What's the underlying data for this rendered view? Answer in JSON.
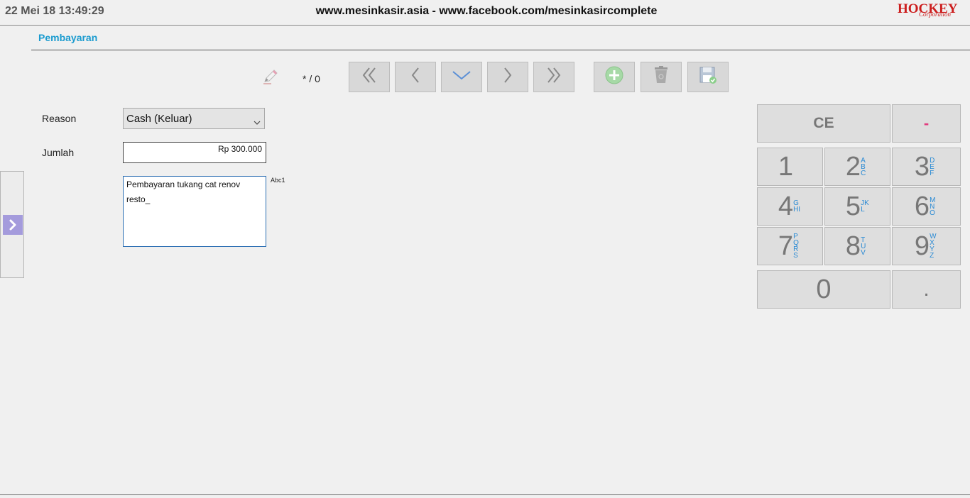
{
  "header": {
    "datetime": "22 Mei 18 13:49:29",
    "site_title": "www.mesinkasir.asia - www.facebook.com/mesinkasircomplete",
    "logo_brand": "HOCKEY",
    "logo_sub": "Corporation"
  },
  "section": {
    "title": "Pembayaran"
  },
  "record": {
    "position": "* / 0"
  },
  "form": {
    "reason_label": "Reason",
    "reason_value": "Cash (Keluar)",
    "amount_label": "Jumlah",
    "amount_value": "Rp 300.000",
    "note_value": "Pembayaran tukang cat renov\nresto_",
    "input_mode": "Abc1"
  },
  "keypad": {
    "ce": "CE",
    "minus": "-",
    "dot": ".",
    "keys": [
      {
        "digit": "1",
        "letters": ""
      },
      {
        "digit": "2",
        "letters": "ABC"
      },
      {
        "digit": "3",
        "letters": "DEF"
      },
      {
        "digit": "4",
        "letters": "GHI"
      },
      {
        "digit": "5",
        "letters": "JKL"
      },
      {
        "digit": "6",
        "letters": "MNO"
      },
      {
        "digit": "7",
        "letters": "PQRS"
      },
      {
        "digit": "8",
        "letters": "TUV"
      },
      {
        "digit": "9",
        "letters": "WXYZ"
      },
      {
        "digit": "0",
        "letters": ""
      }
    ]
  },
  "colors": {
    "accent": "#1a9bcf",
    "keypad_letters": "#2a8ad4",
    "minus_key": "#e23c7e",
    "side_arrow": "#a49bdc",
    "logo": "#cc1d1d"
  },
  "icons": {
    "nav": [
      "first-record-icon",
      "previous-record-icon",
      "down-icon",
      "next-record-icon",
      "last-record-icon"
    ],
    "actions": [
      "add-icon",
      "delete-icon",
      "save-icon"
    ]
  }
}
